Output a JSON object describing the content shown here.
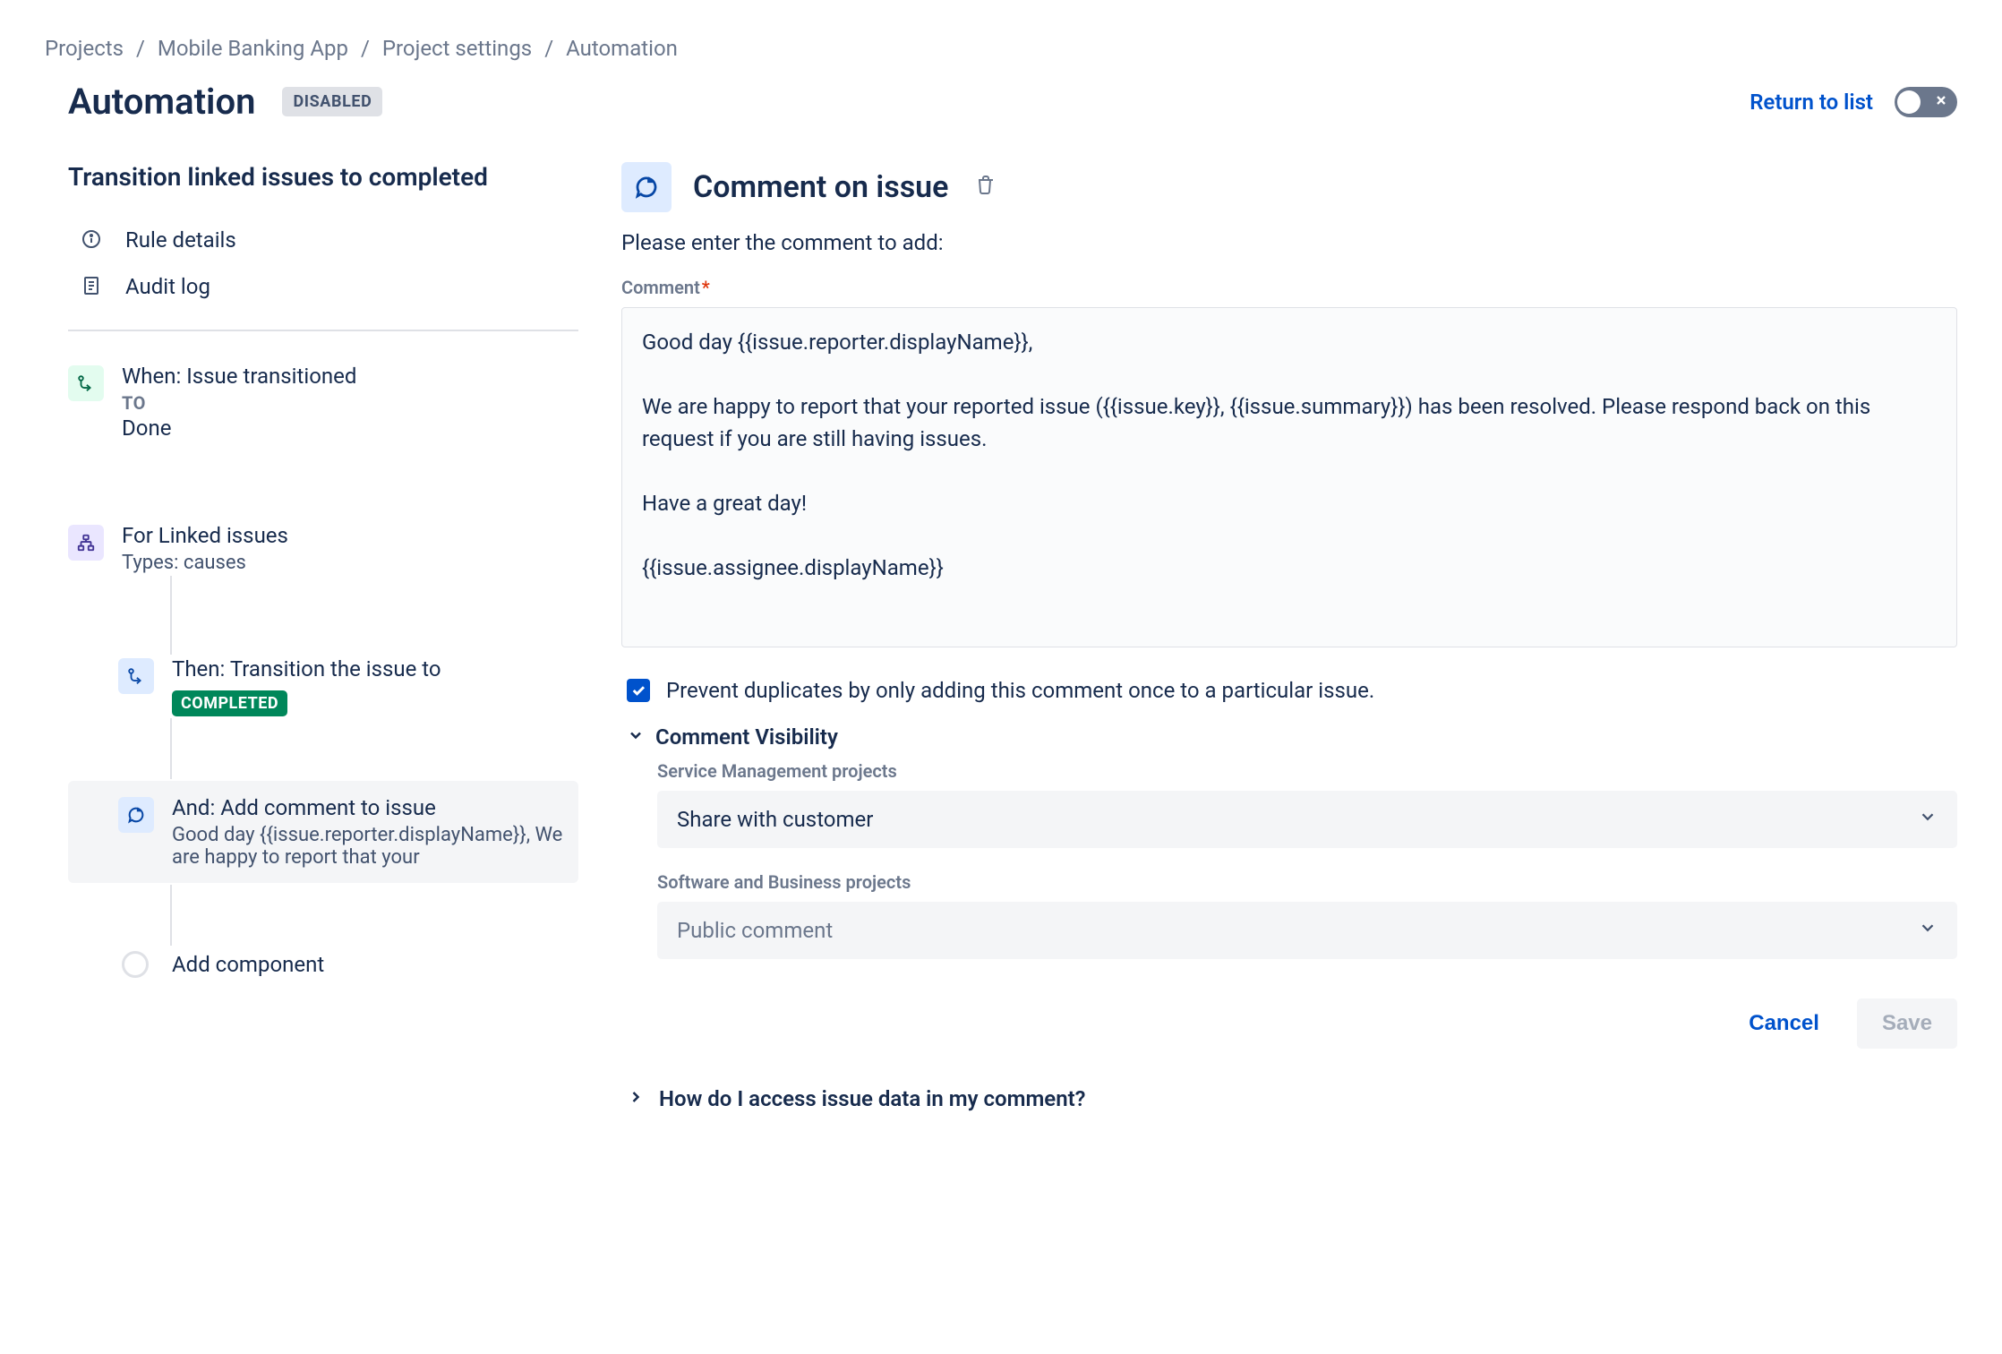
{
  "breadcrumbs": [
    "Projects",
    "Mobile Banking App",
    "Project settings",
    "Automation"
  ],
  "header": {
    "title": "Automation",
    "status": "Disabled",
    "return_link": "Return to list",
    "toggle_on": false
  },
  "left": {
    "rule_name": "Transition linked issues to completed",
    "nav": {
      "rule_details_label": "Rule details",
      "audit_log_label": "Audit log"
    },
    "trigger": {
      "title": "When: Issue transitioned",
      "subtitle": "To",
      "value": "Done"
    },
    "branch": {
      "title": "For Linked issues",
      "value": "Types: causes"
    },
    "action_transition": {
      "title": "Then: Transition the issue to",
      "badge": "Completed"
    },
    "action_comment": {
      "title": "And: Add comment to issue",
      "preview": "Good day {{issue.reporter.displayName}}, We are happy to report that your"
    },
    "add_component_label": "Add component"
  },
  "right": {
    "header_title": "Comment on issue",
    "prompt": "Please enter the comment to add:",
    "comment_label": "Comment",
    "comment_value": "Good day {{issue.reporter.displayName}},\n\nWe are happy to report that your reported issue ({{issue.key}}, {{issue.summary}}) has been resolved. Please respond back on this request if you are still having issues.\n\nHave a great day!\n\n{{issue.assignee.displayName}}",
    "checkbox": {
      "checked": true,
      "label": "Prevent duplicates by only adding this comment once to a particular issue."
    },
    "visibility": {
      "section_title": "Comment Visibility",
      "service_mgmt_label": "Service Management projects",
      "service_mgmt_value": "Share with customer",
      "software_business_label": "Software and Business projects",
      "software_business_value": "Public comment"
    },
    "buttons": {
      "cancel": "Cancel",
      "save": "Save"
    },
    "help_link": "How do I access issue data in my comment?"
  }
}
